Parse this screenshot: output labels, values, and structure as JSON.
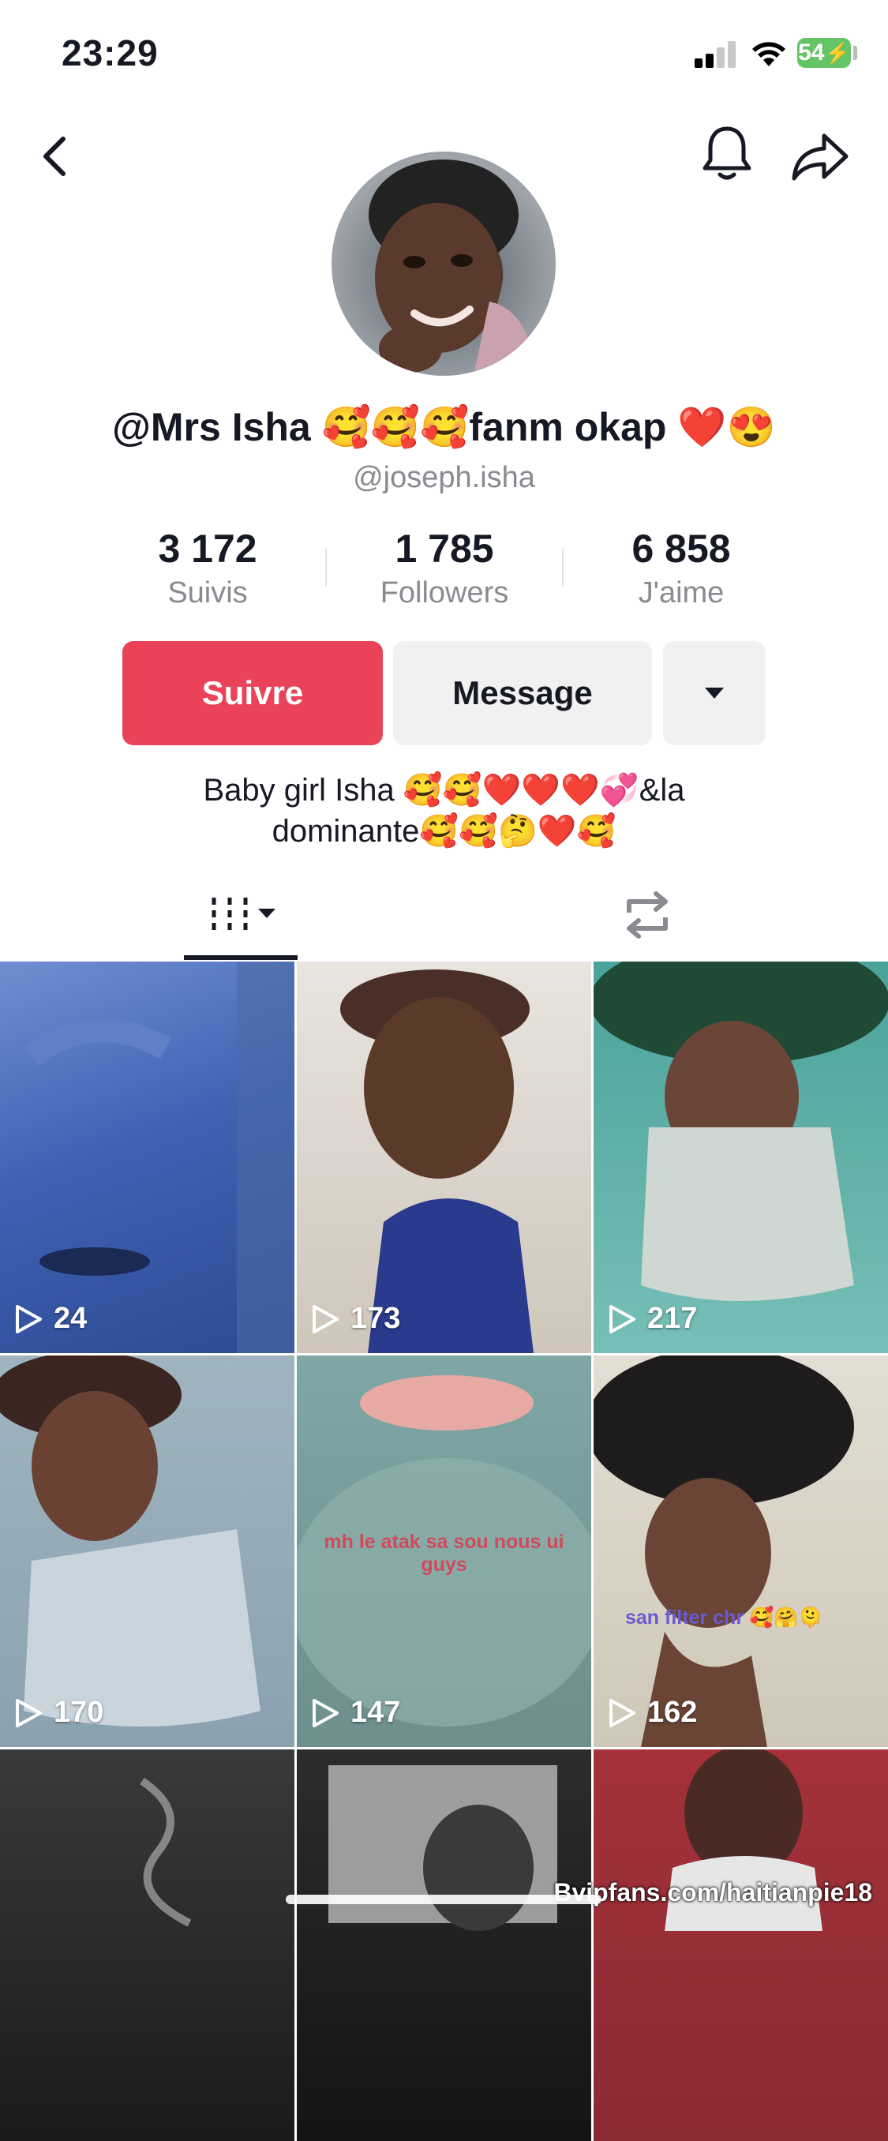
{
  "status_bar": {
    "time": "23:29",
    "battery": "54"
  },
  "profile": {
    "display_name": "@Mrs Isha 🥰🥰🥰fanm okap ❤️😍",
    "username": "@joseph.isha",
    "stats": [
      {
        "value": "3 172",
        "label": "Suivis"
      },
      {
        "value": "1 785",
        "label": "Followers"
      },
      {
        "value": "6 858",
        "label": "J'aime"
      }
    ],
    "follow_label": "Suivre",
    "message_label": "Message",
    "bio_line1": "Baby girl Isha 🥰🥰❤️❤️❤️💞&la",
    "bio_line2": "dominante🥰🥰🤔❤️🥰"
  },
  "tabs": [
    {
      "icon": "grid-icon"
    },
    {
      "icon": "repost-icon"
    }
  ],
  "videos": [
    {
      "views": "24",
      "caption": ""
    },
    {
      "views": "173",
      "caption": ""
    },
    {
      "views": "217",
      "caption": ""
    },
    {
      "views": "170",
      "caption": ""
    },
    {
      "views": "147",
      "caption": "mh le atak sa sou nous ui guys"
    },
    {
      "views": "162",
      "caption": "san filter chr 🥰🤗🫠"
    },
    {
      "views": "",
      "caption": ""
    },
    {
      "views": "",
      "caption": ""
    },
    {
      "views": "",
      "caption": ""
    }
  ],
  "watermark": "Bvipfans.com/haitianpie18",
  "colors": {
    "accent": "#ea4359",
    "muted": "#8a8b91",
    "button_bg": "#f1f1f2"
  }
}
